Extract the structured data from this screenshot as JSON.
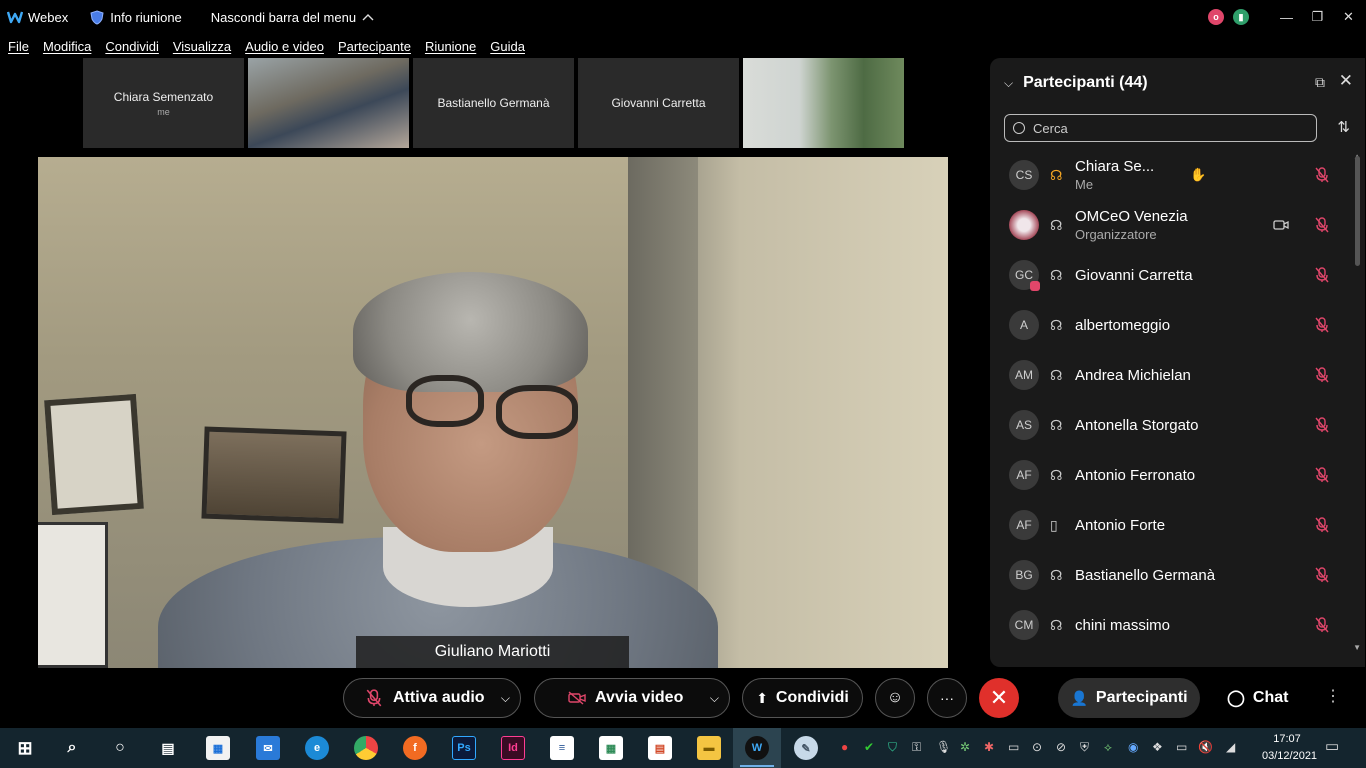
{
  "titlebar": {
    "app_name": "Webex",
    "info_label": "Info riunione",
    "hide_menu_label": "Nascondi barra del menu"
  },
  "menu": [
    "File",
    "Modifica",
    "Condividi",
    "Visualizza",
    "Audio e video",
    "Partecipante",
    "Riunione",
    "Guida"
  ],
  "thumbnails": [
    {
      "name": "Chiara Semenzato",
      "sub": "me"
    },
    {
      "name": "",
      "sub": ""
    },
    {
      "name": "Bastianello Germanà",
      "sub": ""
    },
    {
      "name": "Giovanni Carretta",
      "sub": ""
    },
    {
      "name": "",
      "sub": ""
    }
  ],
  "main_video": {
    "speaker_name": "Giuliano Mariotti"
  },
  "participants_panel": {
    "title": "Partecipanti (44)",
    "search_placeholder": "Cerca",
    "participants": [
      {
        "initials": "CS",
        "name": "Chiara Se...",
        "sub": "Me"
      },
      {
        "initials": "",
        "name": "OMCeO Venezia",
        "sub": "Organizzatore"
      },
      {
        "initials": "GC",
        "name": "Giovanni Carretta",
        "sub": ""
      },
      {
        "initials": "A",
        "name": "albertomeggio",
        "sub": ""
      },
      {
        "initials": "AM",
        "name": "Andrea Michielan",
        "sub": ""
      },
      {
        "initials": "AS",
        "name": "Antonella Storgato",
        "sub": ""
      },
      {
        "initials": "AF",
        "name": "Antonio Ferronato",
        "sub": ""
      },
      {
        "initials": "AF",
        "name": "Antonio Forte",
        "sub": ""
      },
      {
        "initials": "BG",
        "name": "Bastianello Germanà",
        "sub": ""
      },
      {
        "initials": "CM",
        "name": "chini massimo",
        "sub": ""
      }
    ]
  },
  "controls": {
    "audio_label": "Attiva audio",
    "video_label": "Avvia video",
    "share_label": "Condividi",
    "participants_label": "Partecipanti",
    "chat_label": "Chat"
  },
  "taskbar": {
    "time": "17:07",
    "date": "03/12/2021"
  },
  "colors": {
    "end_call": "#e0302b",
    "mute_icon": "#e0466a",
    "raise_hand_status": "#f5a623"
  }
}
